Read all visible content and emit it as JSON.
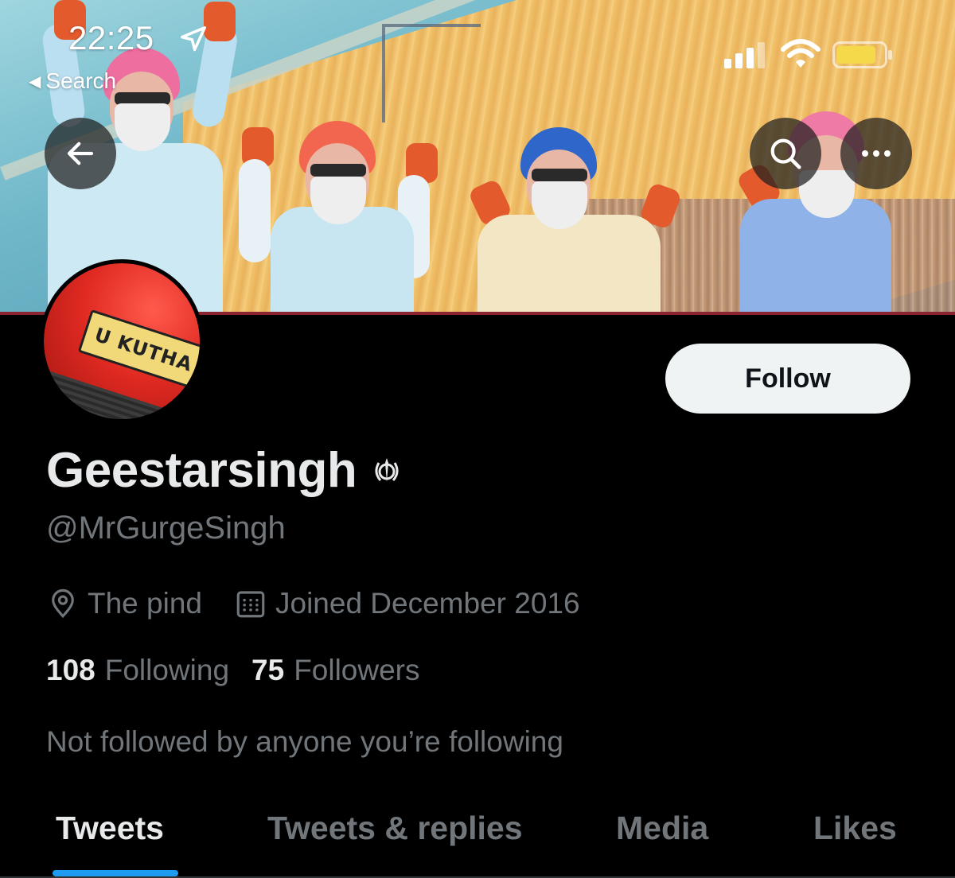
{
  "status_bar": {
    "time": "22:25",
    "back_app_label": "Search"
  },
  "header": {
    "back_icon": "arrow-left-icon",
    "search_icon": "search-icon",
    "more_icon": "more-horizontal-icon"
  },
  "avatar": {
    "plate_text": "U KUTHA"
  },
  "profile": {
    "follow_label": "Follow",
    "display_name": "Geestarsingh",
    "name_emoji": "khanda-icon",
    "handle": "@MrGurgeSingh",
    "location": "The pind",
    "joined": "Joined December 2016",
    "following_count": "108",
    "following_label": "Following",
    "followers_count": "75",
    "followers_label": "Followers",
    "mutuals_text": "Not followed by anyone you’re following"
  },
  "tabs": [
    {
      "label": "Tweets",
      "active": true
    },
    {
      "label": "Tweets & replies",
      "active": false
    },
    {
      "label": "Media",
      "active": false
    },
    {
      "label": "Likes",
      "active": false
    }
  ],
  "colors": {
    "accent": "#1d9bf0",
    "background": "#000000",
    "secondary_text": "#71767b",
    "primary_text": "#e7e9ea",
    "battery": "#f5d94a"
  }
}
